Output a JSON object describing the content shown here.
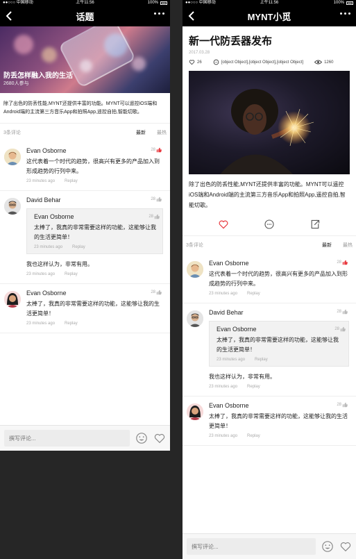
{
  "status_bar": {
    "carrier": "●●○○○ 中国移动",
    "time": "上午11:56",
    "battery": "100%"
  },
  "topic_screen": {
    "nav_title": "话题",
    "hero": {
      "title": "防丢怎样融入我的生活",
      "subtitle": "2680人参与"
    },
    "description": "除了出色的防丢性能,MYNT还提供丰富的功能。MYNT可以遥控iOS端和Android端的主流第三方音乐App和拍照App,遥控自拍,智能切歌。",
    "comment_count": "3条评论",
    "sort_latest": "最新",
    "sort_hottest": "最热",
    "comments": [
      {
        "name": "Evan Osborne",
        "likes": "28",
        "text": "这代表着一个时代的趋势，很高兴有更多的产品加入到形成趋势的行列中来。",
        "time": "23 minutes ago",
        "reply": "Replay"
      },
      {
        "name": "David Behar",
        "likes": "28",
        "quote": {
          "name": "Evan Osborne",
          "likes": "28",
          "text": "太棒了，我真的非常需要这样的功能，这能够让我的生活更简单！",
          "time": "23 minutes ago",
          "reply": "Replay"
        },
        "text": "我也这样认为，非常有用。",
        "time": "23 minutes ago",
        "reply": "Replay"
      },
      {
        "name": "Evan Osborne",
        "likes": "28",
        "text": "太棒了，我真的非常需要这样的功能，这能够让我的生活更简单！",
        "time": "23 minutes ago",
        "reply": "Replay"
      }
    ],
    "input_placeholder": "撰写评论..."
  },
  "article_screen": {
    "nav_title": "MYNT小觅",
    "title": "新一代防丢器发布",
    "date": "2017.03.28",
    "likes": "26",
    "comments": [
      {
        "name": "Evan Osborne",
        "likes": "28",
        "text": "这代表着一个时代的趋势，很高兴有更多的产品加入到形成趋势的行列中来。",
        "time": "23 minutes ago",
        "reply": "Replay"
      },
      {
        "name": "David Behar",
        "likes": "28",
        "quote": {
          "name": "Evan Osborne",
          "likes": "28",
          "text": "太棒了，我真的非常需要这样的功能，这能够让我的生活更简单！",
          "time": "23 minutes ago",
          "reply": "Replay"
        },
        "text": "我也这样认为，非常有用。",
        "time": "23 minutes ago",
        "reply": "Replay"
      },
      {
        "name": "Evan Osborne",
        "likes": "28",
        "text": "太棒了，我真的非常需要这样的功能，这能够让我的生活更简单！",
        "time": "23 minutes ago",
        "reply": "Replay"
      }
    ],
    "views": "1260",
    "body": "除了出色的防丢性能,MYNT还提供丰富的功能。MYNT可以遥控iOS端和Android端的主流第三方音乐App和拍照App,遥控自拍,智能切歌。",
    "comment_count": "3条评论",
    "sort_latest": "最新",
    "sort_hottest": "最热",
    "input_placeholder": "撰写评论..."
  },
  "colors": {
    "nav_bg": "#000000",
    "accent_red": "#e8393f",
    "muted": "#aaaaaa"
  }
}
